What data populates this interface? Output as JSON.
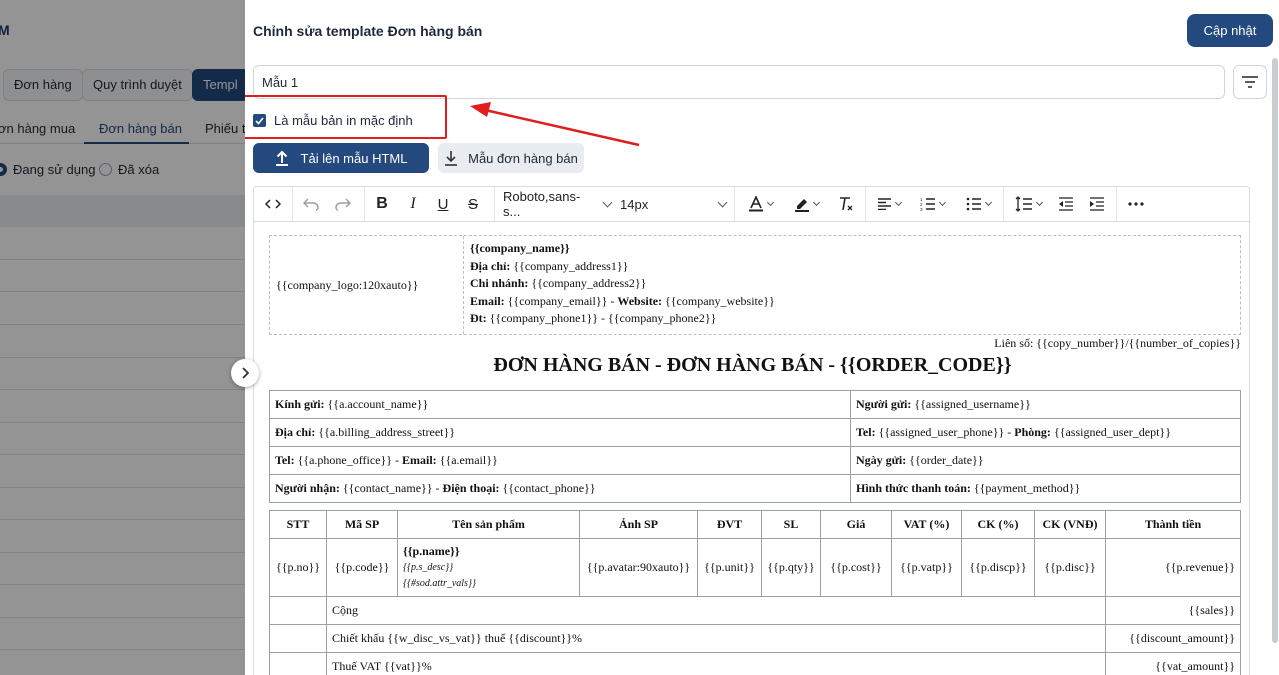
{
  "background": {
    "app_title": "M",
    "buttons": [
      "Đơn hàng",
      "Quy trình duyệt",
      "Templ"
    ],
    "tabs": [
      "ơn hàng mua",
      "Đơn hàng bán",
      "Phiếu t"
    ],
    "radios": [
      "Đang sử dụng",
      "Đã xóa"
    ]
  },
  "drawer": {
    "title": "Chỉnh sửa template Đơn hàng bán",
    "update_label": "Cập nhật",
    "template_name": "Mẫu 1",
    "default_checkbox_label": "Là mẫu bản in mặc định",
    "default_checked": true,
    "upload_label": "Tải lên mẫu HTML",
    "sample_label": "Mẫu đơn hàng bán",
    "annotation_color": "#e11d1d"
  },
  "toolbar": {
    "font_family": "Roboto,sans-s...",
    "font_size": "14px"
  },
  "doc": {
    "logo": "{{company_logo:120xauto}}",
    "company_name": "{{company_name}}",
    "address_label": "Địa chỉ:",
    "address_value": "{{company_address1}}",
    "branch_label": "Chi nhánh:",
    "branch_value": "{{company_address2}}",
    "email_label": "Email:",
    "email_value": "{{company_email}} -",
    "website_label": "Website:",
    "website_value": "{{company_website}}",
    "phone_label": "Đt:",
    "phone_value": "{{company_phone1}} - {{company_phone2}}",
    "copy_line": "Liên số: {{copy_number}}/{{number_of_copies}}",
    "title": "ĐƠN HÀNG BÁN - ĐƠN HÀNG BÁN - {{ORDER_CODE}}",
    "info": {
      "r1c1_label": "Kính gửi:",
      "r1c1_value": "{{a.account_name}}",
      "r1c2_label": "Người gửi:",
      "r1c2_value": "{{assigned_username}}",
      "r2c1_label": "Địa chỉ:",
      "r2c1_value": "{{a.billing_address_street}}",
      "r2c2_label": "Tel:",
      "r2c2_value": "{{assigned_user_phone}} -",
      "r2c2_label2": "Phòng:",
      "r2c2_value2": "{{assigned_user_dept}}",
      "r3c1_label": "Tel:",
      "r3c1_value": "{{a.phone_office}} -",
      "r3c1_label2": "Email:",
      "r3c1_value2": "{{a.email}}",
      "r3c2_label": "Ngày gửi:",
      "r3c2_value": "{{order_date}}",
      "r4c1_label": "Người nhận:",
      "r4c1_value": "{{contact_name}} -",
      "r4c1_label2": "Điện thoại:",
      "r4c1_value2": "{{contact_phone}}",
      "r4c2_label": "Hình thức thanh toán:",
      "r4c2_value": "{{payment_method}}"
    },
    "columns": [
      "STT",
      "Mã SP",
      "Tên sản phẩm",
      "Ảnh SP",
      "ĐVT",
      "SL",
      "Giá",
      "VAT (%)",
      "CK (%)",
      "CK (VNĐ)",
      "Thành tiền"
    ],
    "product_row": {
      "no": "{{p.no}}",
      "code": "{{p.code}}",
      "name": "{{p.name}}",
      "desc": "{{p.s_desc}}",
      "attrs": "{{#sod.attr_vals}}",
      "avatar": "{{p.avatar:90xauto}}",
      "unit": "{{p.unit}}",
      "qty": "{{p.qty}}",
      "cost": "{{p.cost}}",
      "vat": "{{p.vatp}}",
      "discp": "{{p.discp}}",
      "disc": "{{p.disc}}",
      "revenue": "{{p.revenue}}"
    },
    "summary": [
      {
        "label": "Cộng",
        "value": "{{sales}}"
      },
      {
        "label": "Chiết khấu {{w_disc_vs_vat}} thuế {{discount}}%",
        "value": "{{discount_amount}}"
      },
      {
        "label": "Thuế VAT {{vat}}%",
        "value": "{{vat_amount}}"
      }
    ]
  }
}
